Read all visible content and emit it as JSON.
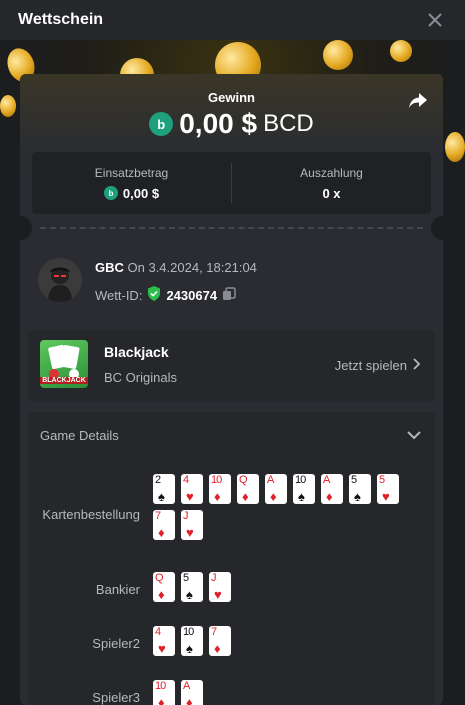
{
  "header": {
    "title": "Wettschein"
  },
  "summary": {
    "win_label": "Gewinn",
    "win_amount": "0,00 $",
    "win_currency": "BCD",
    "stake_label": "Einsatzbetrag",
    "stake_value": "0,00 $",
    "payout_label": "Auszahlung",
    "payout_value": "0 x"
  },
  "bet": {
    "username": "GBC",
    "date_text": "On 3.4.2024, 18:21:04",
    "id_label": "Wett-ID:",
    "id_value": "2430674"
  },
  "game": {
    "thumb_text": "BLACKJACK",
    "name": "Blackjack",
    "provider": "BC Originals",
    "play_label": "Jetzt spielen"
  },
  "details": {
    "header": "Game Details",
    "rows": [
      {
        "label": "Kartenbestellung",
        "cards": [
          {
            "rank": "2",
            "suit": "♠",
            "color": "blk"
          },
          {
            "rank": "4",
            "suit": "♥",
            "color": "red"
          },
          {
            "rank": "10",
            "suit": "♦",
            "color": "red"
          },
          {
            "rank": "Q",
            "suit": "♦",
            "color": "red"
          },
          {
            "rank": "A",
            "suit": "♦",
            "color": "red"
          },
          {
            "rank": "10",
            "suit": "♠",
            "color": "blk"
          },
          {
            "rank": "A",
            "suit": "♦",
            "color": "red"
          },
          {
            "rank": "5",
            "suit": "♠",
            "color": "blk"
          },
          {
            "rank": "5",
            "suit": "♥",
            "color": "red"
          },
          {
            "rank": "7",
            "suit": "♦",
            "color": "red"
          },
          {
            "rank": "J",
            "suit": "♥",
            "color": "red"
          }
        ]
      },
      {
        "label": "Bankier",
        "cards": [
          {
            "rank": "Q",
            "suit": "♦",
            "color": "red"
          },
          {
            "rank": "5",
            "suit": "♠",
            "color": "blk"
          },
          {
            "rank": "J",
            "suit": "♥",
            "color": "red"
          }
        ]
      },
      {
        "label": "Spieler2",
        "cards": [
          {
            "rank": "4",
            "suit": "♥",
            "color": "red"
          },
          {
            "rank": "10",
            "suit": "♠",
            "color": "blk"
          },
          {
            "rank": "7",
            "suit": "♦",
            "color": "red"
          }
        ]
      },
      {
        "label": "Spieler3",
        "cards": [
          {
            "rank": "10",
            "suit": "♦",
            "color": "red"
          },
          {
            "rank": "A",
            "suit": "♦",
            "color": "red"
          }
        ]
      }
    ]
  },
  "colors": {
    "accent_green": "#1fa07c",
    "card_red": "#e0202a",
    "bg": "#1b1d21",
    "panel": "#2a2c31"
  }
}
